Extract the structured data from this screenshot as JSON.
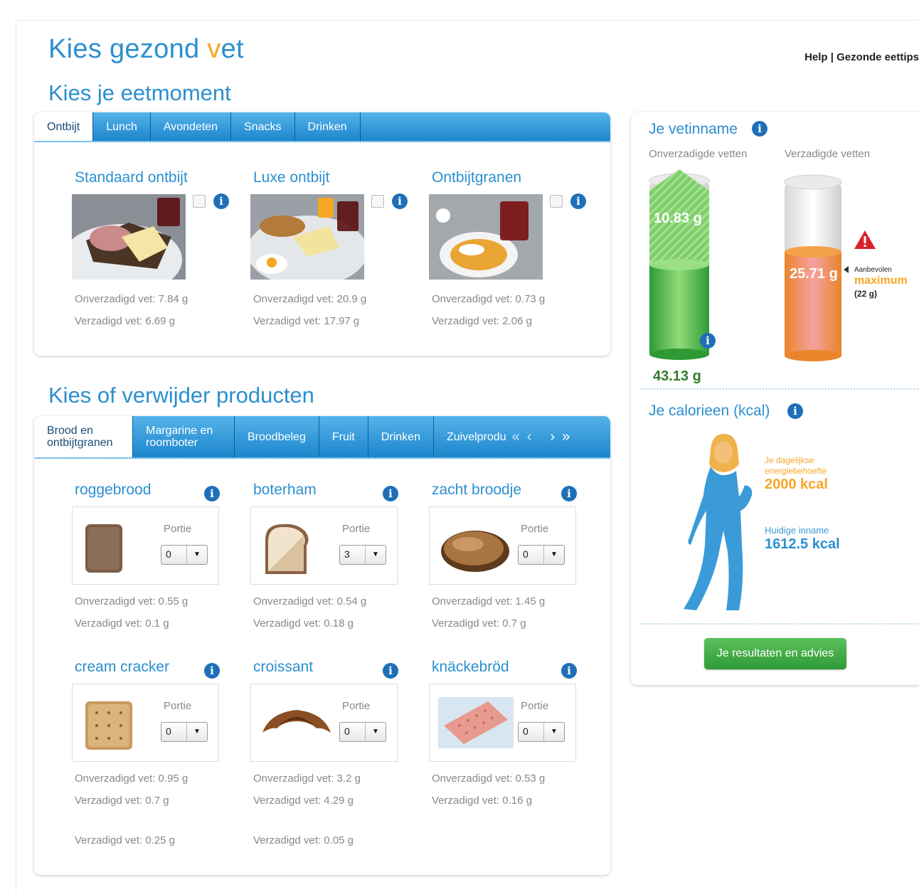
{
  "header": {
    "title_part1": "Kies gezond ",
    "title_accent": "v",
    "title_part2": "et",
    "help": "Help",
    "separator": "|",
    "tips": "Gezonde eettips"
  },
  "colors": {
    "brand_blue": "#2b8fd0",
    "accent_orange": "#f5a623",
    "green": "#3aa53e",
    "orange_bar": "#f0922a"
  },
  "eetmoment": {
    "heading": "Kies je eetmoment",
    "tabs": [
      "Ontbijt",
      "Lunch",
      "Avondeten",
      "Snacks",
      "Drinken"
    ],
    "active_tab": "Ontbijt",
    "meals": [
      {
        "title": "Standaard ontbijt",
        "unsat": "Onverzadigd vet: 7.84 g",
        "sat": "Verzadigd vet: 6.69 g",
        "icon": "info-icon"
      },
      {
        "title": "Luxe ontbijt",
        "unsat": "Onverzadigd vet: 20.9 g",
        "sat": "Verzadigd vet: 17.97 g",
        "icon": "info-icon"
      },
      {
        "title": "Ontbijtgranen",
        "unsat": "Onverzadigd vet: 0.73 g",
        "sat": "Verzadigd vet: 2.06 g",
        "icon": "info-icon"
      }
    ]
  },
  "producten": {
    "heading": "Kies of verwijder producten",
    "tabs": [
      "Brood en ontbijtgranen",
      "Margarine en roomboter",
      "Broodbeleg",
      "Fruit",
      "Drinken",
      "Zuivelprodu"
    ],
    "nav": {
      "first": "«",
      "prev": "‹",
      "next": "›",
      "last": "»"
    },
    "portie_label": "Portie",
    "items": [
      {
        "title": "roggebrood",
        "portie": "0",
        "unsat": "Onverzadigd vet: 0.55 g",
        "sat": "Verzadigd vet: 0.1 g"
      },
      {
        "title": "boterham",
        "portie": "3",
        "unsat": "Onverzadigd vet: 0.54 g",
        "sat": "Verzadigd vet: 0.18 g"
      },
      {
        "title": "zacht broodje",
        "portie": "0",
        "unsat": "Onverzadigd vet: 1.45 g",
        "sat": "Verzadigd vet: 0.7 g"
      },
      {
        "title": "cream cracker",
        "portie": "0",
        "unsat": "Onverzadigd vet: 0.95 g",
        "sat": "Verzadigd vet: 0.7 g"
      },
      {
        "title": "croissant",
        "portie": "0",
        "unsat": "Onverzadigd vet: 3.2 g",
        "sat": "Verzadigd vet: 4.29 g"
      },
      {
        "title": "knäckebröd",
        "portie": "0",
        "unsat": "Onverzadigd vet: 0.53 g",
        "sat": "Verzadigd vet: 0.16 g"
      }
    ],
    "extra_row": [
      "Verzadigd vet: 0.25 g",
      "Verzadigd vet: 0.05 g"
    ]
  },
  "vetinname": {
    "heading": "Je vetinname",
    "unsat_label": "Onverzadigde vetten",
    "sat_label": "Verzadigde vetten",
    "unsat_bar_value": "10.83 g",
    "unsat_total": "43.13 g",
    "sat_value": "25.71 g",
    "aanbevolen": "Aanbevolen",
    "maximum": "maximum",
    "max_value": "(22 g)"
  },
  "calorieen": {
    "heading": "Je calorieen (kcal)",
    "need_label": "Je dagelijkse energiebehoefte",
    "need_value": "2000 kcal",
    "intake_label": "Huidige inname",
    "intake_value": "1612.5 kcal"
  },
  "result_button": "Je resultaten en advies"
}
